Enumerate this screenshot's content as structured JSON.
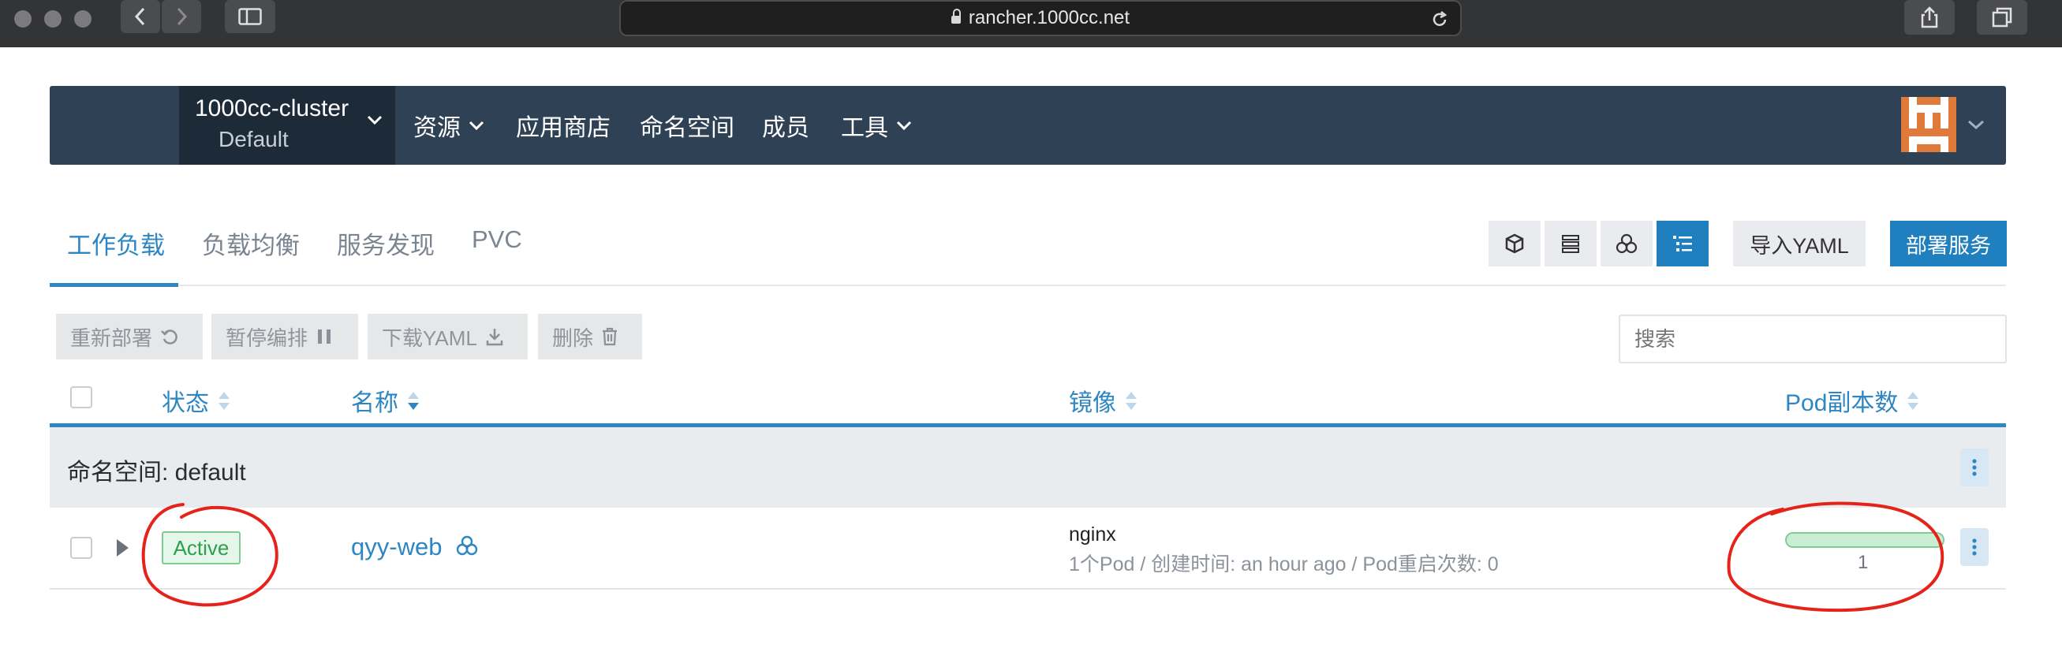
{
  "browser": {
    "url": "rancher.1000cc.net"
  },
  "navbar": {
    "cluster_name": "1000cc-cluster",
    "project_name": "Default",
    "items": [
      {
        "label": "资源",
        "has_dropdown": true
      },
      {
        "label": "应用商店",
        "has_dropdown": false
      },
      {
        "label": "命名空间",
        "has_dropdown": false
      },
      {
        "label": "成员",
        "has_dropdown": false
      },
      {
        "label": "工具",
        "has_dropdown": true
      }
    ]
  },
  "tabs": [
    {
      "label": "工作负载",
      "active": true
    },
    {
      "label": "负载均衡",
      "active": false
    },
    {
      "label": "服务发现",
      "active": false
    },
    {
      "label": "PVC",
      "active": false
    }
  ],
  "view_buttons": [
    {
      "icon": "cube-icon",
      "active": false
    },
    {
      "icon": "list-icon",
      "active": false
    },
    {
      "icon": "cubes-icon",
      "active": false
    },
    {
      "icon": "grouped-list-icon",
      "active": true
    }
  ],
  "actions": {
    "import_yaml": "导入YAML",
    "deploy": "部署服务"
  },
  "bulk": {
    "redeploy": "重新部署",
    "pause": "暂停编排",
    "download": "下载YAML",
    "delete": "删除"
  },
  "search": {
    "placeholder": "搜索"
  },
  "table": {
    "headers": {
      "state": "状态",
      "name": "名称",
      "image": "镜像",
      "pods": "Pod副本数"
    },
    "group": {
      "label": "命名空间: default"
    },
    "rows": [
      {
        "state": "Active",
        "name": "qyy-web",
        "image": "nginx",
        "detail": "1个Pod / 创建时间: an hour ago / Pod重启次数: 0",
        "pods": "1",
        "pod_progress": 1.0
      }
    ]
  },
  "colors": {
    "accent": "#2e86c3",
    "nav_bg": "#2f4155",
    "nav_cluster_bg": "#1d2a38",
    "active_green": "#2f9e4f",
    "annotation_red": "#e5231b"
  }
}
